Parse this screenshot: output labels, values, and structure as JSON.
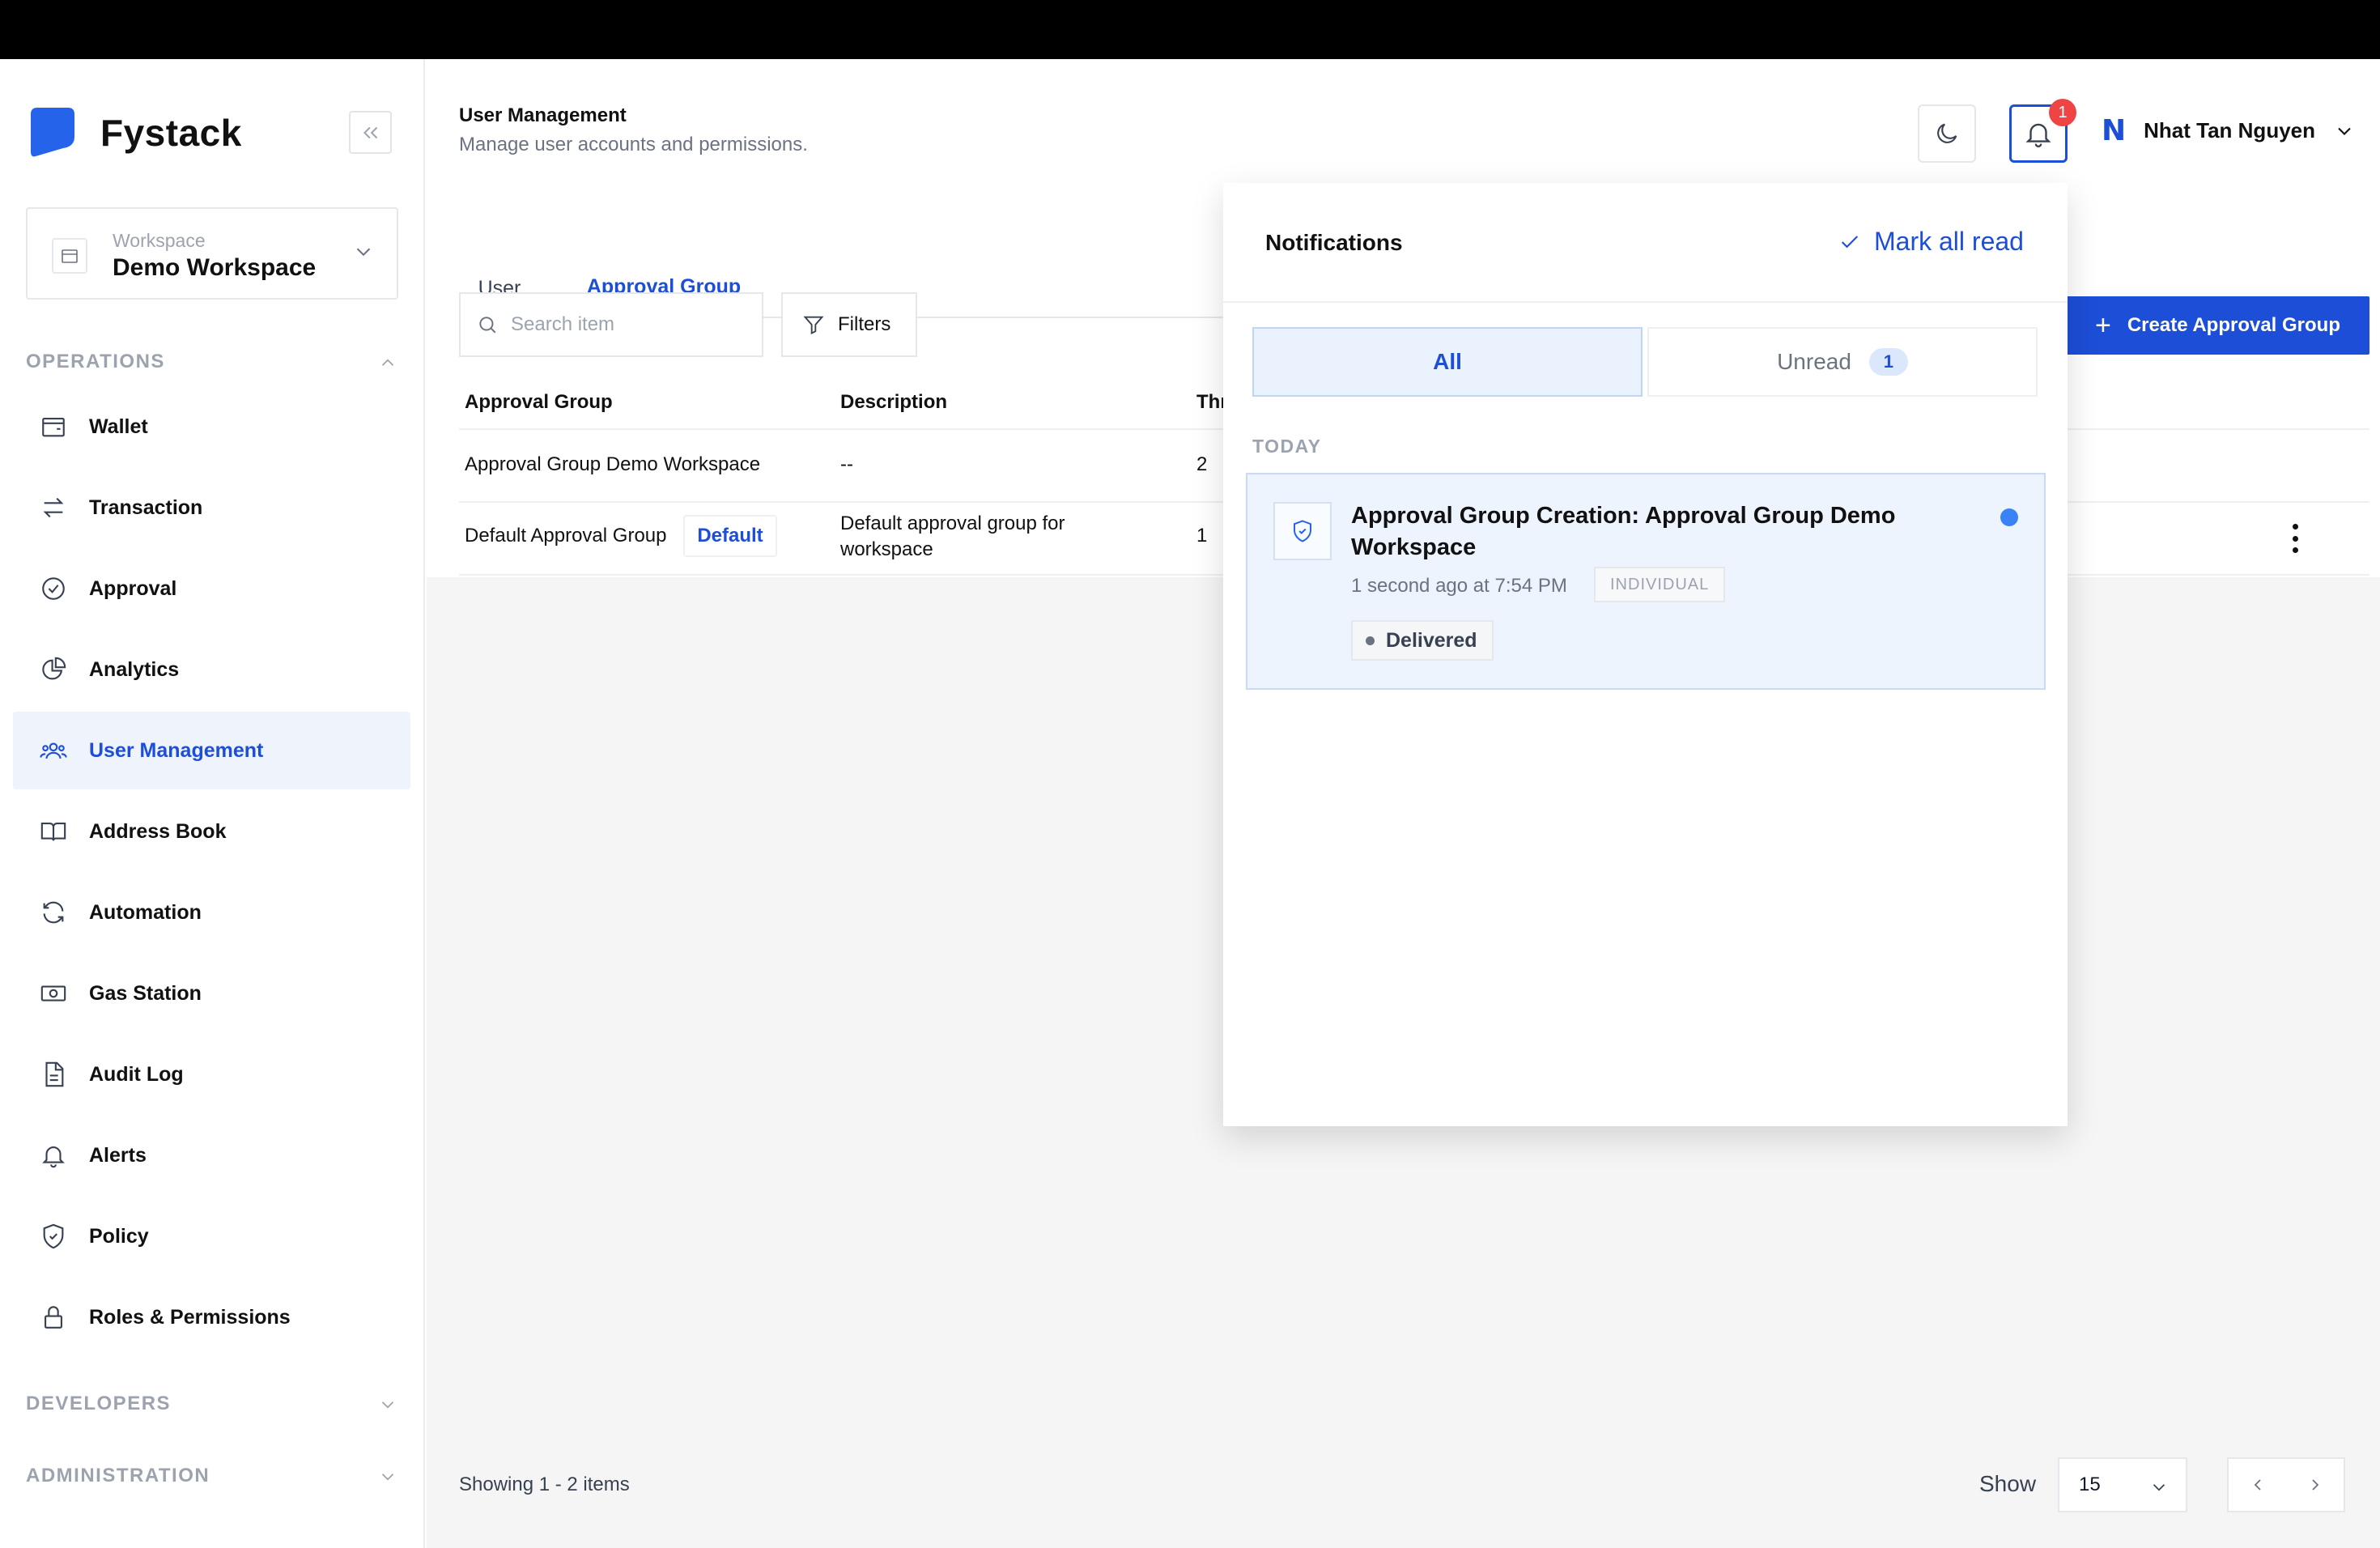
{
  "app": {
    "name": "Fystack"
  },
  "workspace": {
    "label": "Workspace",
    "name": "Demo Workspace"
  },
  "sidebar": {
    "operations_label": "OPERATIONS",
    "developers_label": "DEVELOPERS",
    "administration_label": "ADMINISTRATION",
    "items": [
      {
        "label": "Wallet",
        "icon": "wallet-icon"
      },
      {
        "label": "Transaction",
        "icon": "transfer-icon"
      },
      {
        "label": "Approval",
        "icon": "check-circle-icon"
      },
      {
        "label": "Analytics",
        "icon": "pie-chart-icon"
      },
      {
        "label": "User Management",
        "icon": "users-icon",
        "active": true
      },
      {
        "label": "Address Book",
        "icon": "book-icon"
      },
      {
        "label": "Automation",
        "icon": "refresh-icon"
      },
      {
        "label": "Gas Station",
        "icon": "money-icon"
      },
      {
        "label": "Audit Log",
        "icon": "file-icon"
      },
      {
        "label": "Alerts",
        "icon": "bell-icon"
      },
      {
        "label": "Policy",
        "icon": "shield-icon"
      },
      {
        "label": "Roles & Permissions",
        "icon": "lock-icon"
      }
    ]
  },
  "header": {
    "title": "User Management",
    "subtitle": "Manage user accounts and permissions.",
    "notification_count": "1",
    "user_initial": "N",
    "user_name": "Nhat Tan Nguyen"
  },
  "tabs": [
    {
      "label": "User"
    },
    {
      "label": "Approval Group",
      "active": true
    }
  ],
  "toolbar": {
    "search_placeholder": "Search item",
    "filters_label": "Filters",
    "create_label": "Create Approval Group"
  },
  "table": {
    "columns": [
      "Approval Group",
      "Description",
      "Thr"
    ],
    "rows": [
      {
        "name": "Approval Group Demo Workspace",
        "description": "--",
        "threshold": "2"
      },
      {
        "name": "Default Approval Group",
        "badge": "Default",
        "description_line1": "Default approval group for",
        "description_line2": "workspace",
        "threshold": "1"
      }
    ]
  },
  "footer": {
    "showing": "Showing 1 - 2 items",
    "show_label": "Show",
    "page_size": "15"
  },
  "notifications": {
    "title": "Notifications",
    "mark_all": "Mark all read",
    "tab_all": "All",
    "tab_unread": "Unread",
    "unread_count": "1",
    "group_label": "TODAY",
    "items": [
      {
        "title": "Approval Group Creation: Approval Group Demo Workspace",
        "time": "1 second ago at 7:54 PM",
        "tag": "INDIVIDUAL",
        "status": "Delivered"
      }
    ]
  },
  "colors": {
    "accent": "#1d4ed8",
    "badge": "#ef4444",
    "unread_dot": "#3b82f6"
  }
}
